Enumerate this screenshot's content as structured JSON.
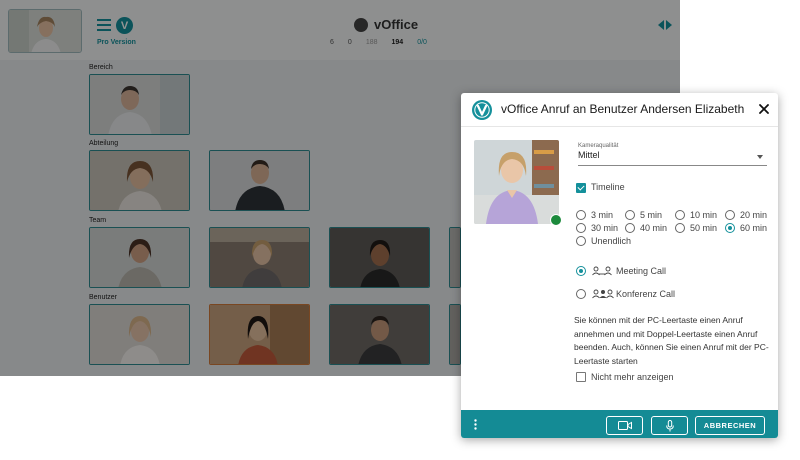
{
  "app": {
    "pro_version": "Pro Version",
    "brand_name": "vOffice",
    "stats": [
      "6",
      "0",
      "188",
      "194",
      "0/0"
    ],
    "sections": {
      "bereich": "Bereich",
      "abteilung": "Abteilung",
      "team": "Team",
      "benutzer": "Benutzer"
    }
  },
  "dialog": {
    "title": "vOffice Anruf an Benutzer Andersen Elizabeth",
    "camera_quality_label": "Kameraqualität",
    "camera_quality_value": "Mittel",
    "timeline_label": "Timeline",
    "durations": [
      "3 min",
      "5 min",
      "10 min",
      "20 min",
      "30 min",
      "40 min",
      "50 min",
      "60 min",
      "Unendlich"
    ],
    "selected_duration": "60 min",
    "meeting_call": "Meeting Call",
    "conference_call": "Konferenz Call",
    "info_text": "Sie können mit der PC-Leertaste einen Anruf annehmen und mit Doppel-Leertaste einen Anruf beenden. Auch, können Sie einen Anruf mit der PC-Leertaste starten",
    "dont_show_again": "Nicht mehr anzeigen",
    "cancel_label": "ABBRECHEN"
  },
  "colors": {
    "accent": "#14909b",
    "footer": "#148b95",
    "online": "#1c8a3c",
    "status_orange": "#d07a3c"
  }
}
